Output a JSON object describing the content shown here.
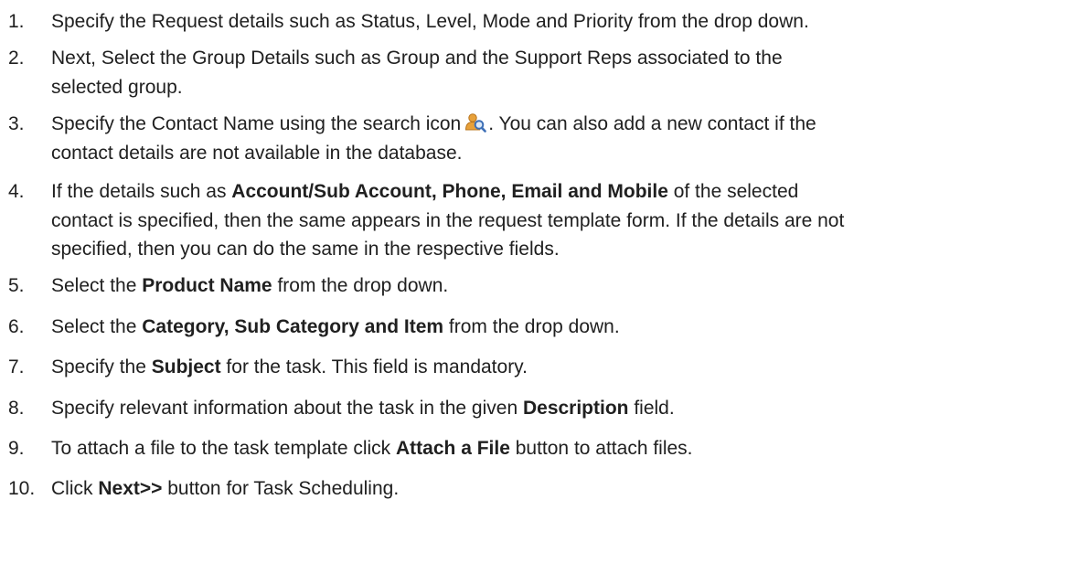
{
  "steps": [
    {
      "number": "1.",
      "lines": [
        [
          "Specify the Request details such as Status, Level, Mode and Priority from the drop down."
        ]
      ]
    },
    {
      "number": "2.",
      "lines": [
        [
          "Next, Select the Group Details such as Group and the Support Reps associated to the"
        ],
        [
          "selected group."
        ]
      ]
    },
    {
      "number": "3.",
      "icon": "contact-search-icon",
      "lines": [
        [
          "Specify the Contact Name using the search icon",
          ". You can also add a new contact if the"
        ],
        [
          "contact details are not available in the database."
        ]
      ]
    },
    {
      "number": "4.",
      "lines": [
        [
          "If the details such as ",
          "Account/Sub Account, Phone, Email and Mobile",
          " of the selected"
        ],
        [
          "contact is specified, then the same appears in the request template form. If the details are not"
        ],
        [
          "specified, then you can do the same in the respective fields."
        ]
      ]
    },
    {
      "number": "5.",
      "lines": [
        [
          "Select the ",
          "Product Name",
          " from the drop down."
        ]
      ]
    },
    {
      "number": "6.",
      "lines": [
        [
          "Select the ",
          "Category, Sub Category and Item",
          " from the drop down."
        ]
      ]
    },
    {
      "number": "7.",
      "lines": [
        [
          "Specify the ",
          "Subject",
          " for the task. This field is mandatory."
        ]
      ]
    },
    {
      "number": "8.",
      "lines": [
        [
          "Specify relevant information about the task in the given ",
          "Description",
          " field."
        ]
      ]
    },
    {
      "number": "9.",
      "lines": [
        [
          "To attach a file to the task template click ",
          "Attach a File",
          " button to attach files."
        ]
      ]
    },
    {
      "number": "10.",
      "lines": [
        [
          "Click ",
          "Next>>",
          " button for Task Scheduling."
        ]
      ]
    }
  ],
  "colors": {
    "text": "#202020",
    "icon_person": "#e8a13a",
    "icon_lens": "#3d6fb6"
  }
}
